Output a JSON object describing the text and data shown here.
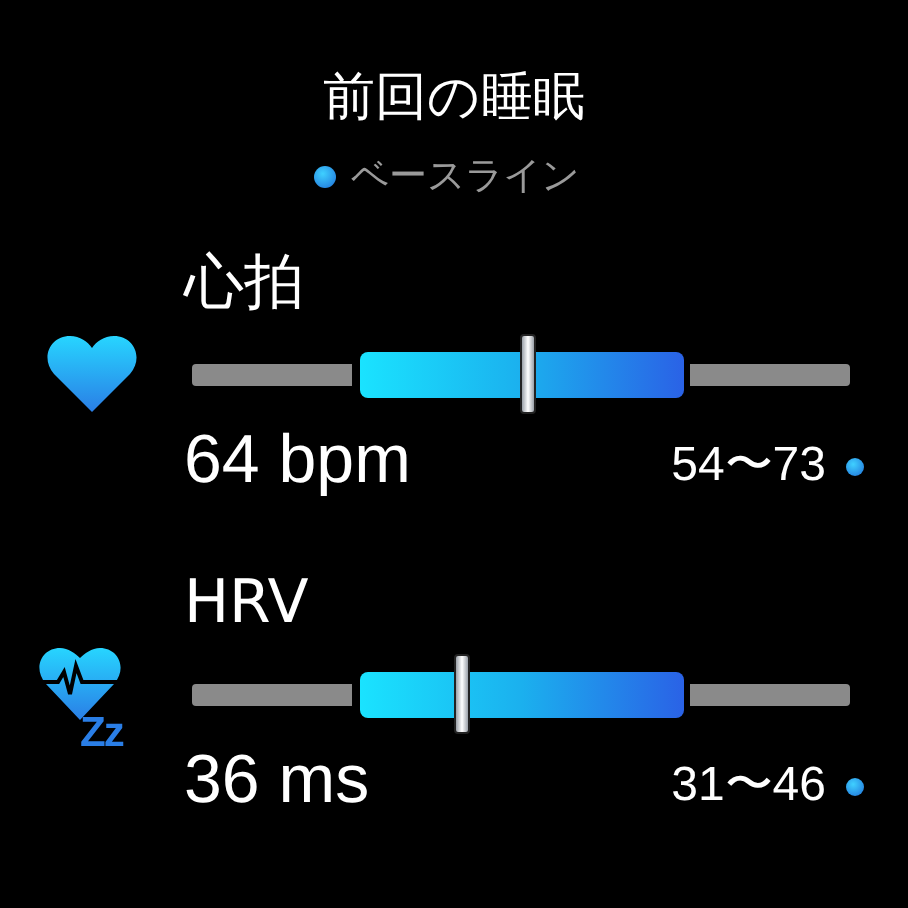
{
  "title": "前回の睡眠",
  "legend": {
    "label": "ベースライン"
  },
  "metrics": [
    {
      "kind": "heart",
      "label": "心拍",
      "level": 0.51,
      "value": "64 bpm",
      "range": "54〜73"
    },
    {
      "kind": "hrv",
      "label": "HRV",
      "level": 0.41,
      "value": "36 ms",
      "range": "31〜46",
      "badge": "Zz"
    }
  ]
}
